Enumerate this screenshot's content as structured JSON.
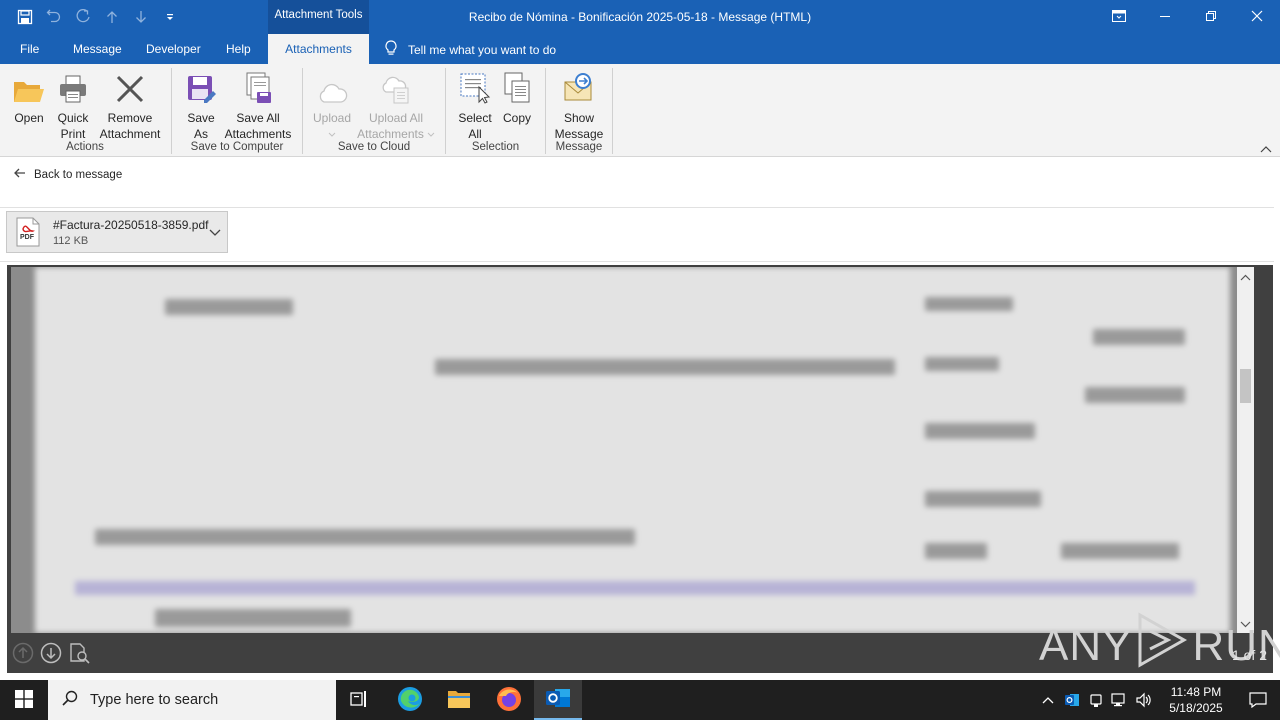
{
  "window": {
    "title": "Recibo de Nómina - Bonificación 2025-05-18  -  Message (HTML)",
    "context_tab": "Attachment Tools"
  },
  "tabs": [
    "File",
    "Message",
    "Developer",
    "Help",
    "Attachments"
  ],
  "active_tab": "Attachments",
  "tell_me": "Tell me what you want to do",
  "ribbon": {
    "open": "Open",
    "quick_print": [
      "Quick",
      "Print"
    ],
    "remove_attachment": [
      "Remove",
      "Attachment"
    ],
    "group_actions": "Actions",
    "save_as": [
      "Save",
      "As"
    ],
    "save_all": [
      "Save All",
      "Attachments"
    ],
    "group_save_computer": "Save to Computer",
    "upload": "Upload",
    "upload_all": [
      "Upload All",
      "Attachments"
    ],
    "group_save_cloud": "Save to Cloud",
    "select_all": [
      "Select",
      "All"
    ],
    "copy": "Copy",
    "group_selection": "Selection",
    "show_message": [
      "Show",
      "Message"
    ],
    "group_message": "Message"
  },
  "back_link": "Back to message",
  "attachment": {
    "name": "#Factura-20250518-3859.pdf",
    "size": "112 KB",
    "type_badge": "PDF"
  },
  "preview": {
    "page_indicator": "1 of 2",
    "watermark": [
      "ANY",
      "RUN"
    ]
  },
  "taskbar": {
    "search_placeholder": "Type here to search",
    "time": "11:48 PM",
    "date": "5/18/2025"
  },
  "colors": {
    "title_bar": "#1a61b5",
    "ribbon_bg": "#f3f3f3",
    "taskbar_bg": "#1f1f1f"
  }
}
